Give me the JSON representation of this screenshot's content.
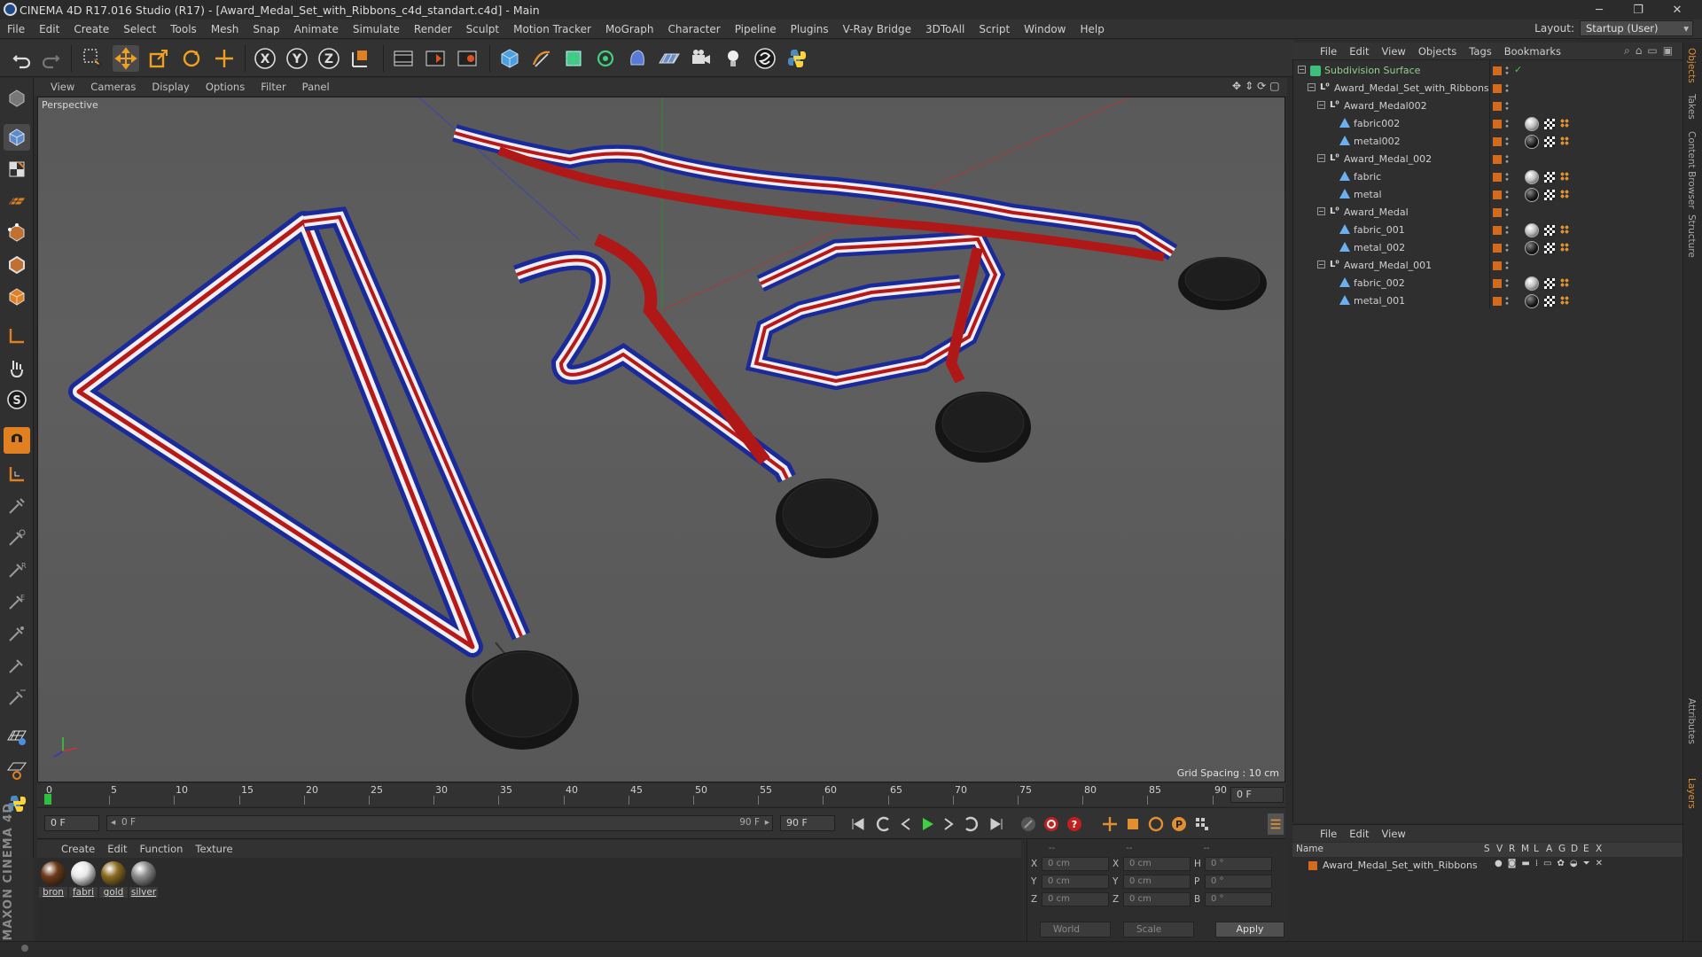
{
  "window": {
    "title": "CINEMA 4D R17.016 Studio (R17) - [Award_Medal_Set_with_Ribbons_c4d_standart.c4d] - Main"
  },
  "menubar": [
    "File",
    "Edit",
    "Create",
    "Select",
    "Tools",
    "Mesh",
    "Snap",
    "Animate",
    "Simulate",
    "Render",
    "Sculpt",
    "Motion Tracker",
    "MoGraph",
    "Character",
    "Pipeline",
    "Plugins",
    "V-Ray Bridge",
    "3DToAll",
    "Script",
    "Window",
    "Help"
  ],
  "layout": {
    "label": "Layout:",
    "value": "Startup (User)"
  },
  "toolbar_icons": [
    "undo-icon",
    "redo-icon",
    "live-selection-icon",
    "move-icon",
    "scale-icon",
    "rotate-icon",
    "recent-tool-icon",
    "x-axis-icon",
    "y-axis-icon",
    "z-axis-icon",
    "coordinate-system-icon",
    "render-view-icon",
    "render-picture-viewer-icon",
    "render-settings-icon",
    "cube-icon",
    "pen-icon",
    "subdivision-icon",
    "cloner-icon",
    "deformer-icon",
    "floor-icon",
    "camera-icon",
    "light-icon",
    "scripting-icon",
    "python-icon"
  ],
  "viewport": {
    "menu": [
      "View",
      "Cameras",
      "Display",
      "Options",
      "Filter",
      "Panel"
    ],
    "label": "Perspective",
    "grid_spacing": "Grid Spacing : 10 cm"
  },
  "timeline": {
    "ticks": [
      "0",
      "5",
      "10",
      "15",
      "20",
      "25",
      "30",
      "35",
      "40",
      "45",
      "50",
      "55",
      "60",
      "65",
      "70",
      "75",
      "80",
      "85",
      "90"
    ],
    "end_field": "0 F",
    "current_frame": "0 F",
    "range_start": "0 F",
    "range_end": "90 F",
    "max_frame": "90 F"
  },
  "materials": {
    "menu": [
      "Create",
      "Edit",
      "Function",
      "Texture"
    ],
    "items": [
      {
        "label": "bron",
        "color": "#6b3a18"
      },
      {
        "label": "fabri",
        "color": "#e8e8e8"
      },
      {
        "label": "gold",
        "color": "#8a6a1e"
      },
      {
        "label": "silver",
        "color": "#8c8c8c"
      }
    ]
  },
  "coordinates": {
    "header": [
      "--",
      "--",
      "--"
    ],
    "rows": [
      {
        "a": "X",
        "av": "0 cm",
        "b": "X",
        "bv": "0 cm",
        "c": "H",
        "cv": "0 °"
      },
      {
        "a": "Y",
        "av": "0 cm",
        "b": "Y",
        "bv": "0 cm",
        "c": "P",
        "cv": "0 °"
      },
      {
        "a": "Z",
        "av": "0 cm",
        "b": "Z",
        "bv": "0 cm",
        "c": "B",
        "cv": "0 °"
      }
    ],
    "mode": "World",
    "scale": "Scale",
    "apply": "Apply"
  },
  "object_manager": {
    "menu": [
      "File",
      "Edit",
      "View",
      "Objects",
      "Tags",
      "Bookmarks"
    ],
    "objects": [
      {
        "name": "Subdivision Surface",
        "depth": 0,
        "type": "subdivision"
      },
      {
        "name": "Award_Medal_Set_with_Ribbons",
        "depth": 1,
        "type": "null"
      },
      {
        "name": "Award_Medal002",
        "depth": 2,
        "type": "null"
      },
      {
        "name": "fabric002",
        "depth": 3,
        "type": "mesh",
        "tag": "fabric"
      },
      {
        "name": "metal002",
        "depth": 3,
        "type": "mesh",
        "tag": "metal"
      },
      {
        "name": "Award_Medal_002",
        "depth": 2,
        "type": "null"
      },
      {
        "name": "fabric",
        "depth": 3,
        "type": "mesh",
        "tag": "fabric"
      },
      {
        "name": "metal",
        "depth": 3,
        "type": "mesh",
        "tag": "metal"
      },
      {
        "name": "Award_Medal",
        "depth": 2,
        "type": "null"
      },
      {
        "name": "fabric_001",
        "depth": 3,
        "type": "mesh",
        "tag": "fabric"
      },
      {
        "name": "metal_002",
        "depth": 3,
        "type": "mesh",
        "tag": "metal"
      },
      {
        "name": "Award_Medal_001",
        "depth": 2,
        "type": "null"
      },
      {
        "name": "fabric_002",
        "depth": 3,
        "type": "mesh",
        "tag": "fabric"
      },
      {
        "name": "metal_001",
        "depth": 3,
        "type": "mesh",
        "tag": "metal"
      }
    ]
  },
  "layer_manager": {
    "menu": [
      "File",
      "Edit",
      "View"
    ],
    "columns": [
      "Name",
      "S",
      "V",
      "R",
      "M",
      "L",
      "A",
      "G",
      "D",
      "E",
      "X"
    ],
    "row": "Award_Medal_Set_with_Ribbons"
  },
  "side_tabs": [
    "Objects",
    "Takes",
    "Content Browser",
    "Structure",
    "Attributes",
    "Layers"
  ],
  "brand": "MAXON CINEMA 4D",
  "colors": {
    "accent_orange": "#d36a1c",
    "ribbon_red": "#b01818",
    "ribbon_blue": "#1b2a9a",
    "medal": "#1b1b1b"
  }
}
